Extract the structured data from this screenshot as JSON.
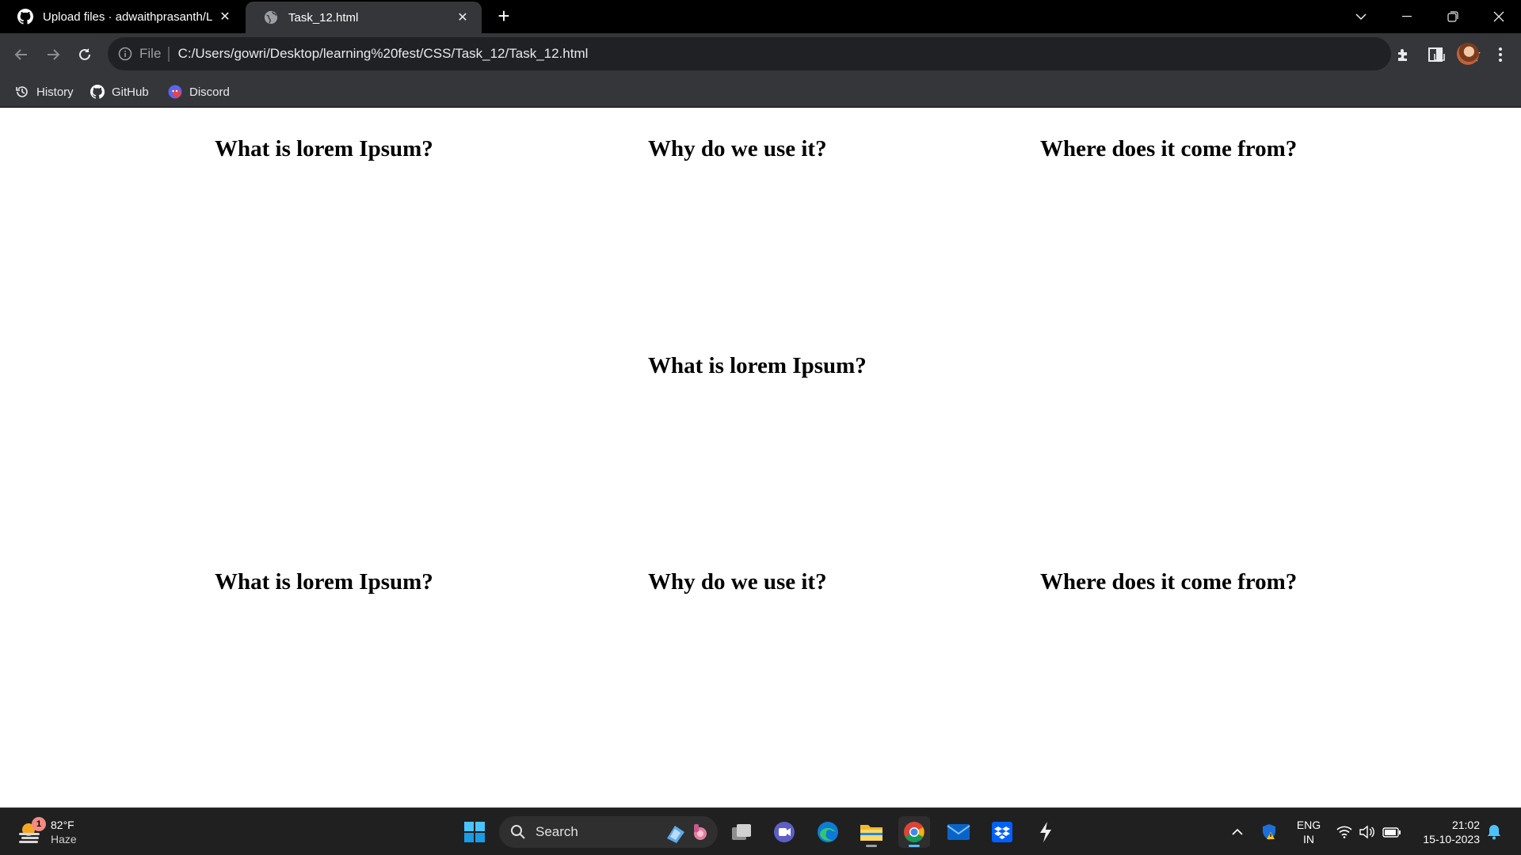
{
  "browser": {
    "tabs": [
      {
        "title": "Upload files · adwaithprasanth/L",
        "favicon": "github-icon",
        "active": false
      },
      {
        "title": "Task_12.html",
        "favicon": "globe-icon",
        "active": true
      }
    ],
    "address": {
      "scheme_label": "File",
      "url": "C:/Users/gowri/Desktop/learning%20fest/CSS/Task_12/Task_12.html"
    },
    "bookmarks": [
      {
        "label": "History",
        "icon": "history-icon"
      },
      {
        "label": "GitHub",
        "icon": "github-icon"
      },
      {
        "label": "Discord",
        "icon": "discord-icon"
      }
    ]
  },
  "page": {
    "rows": [
      [
        "What is lorem Ipsum?",
        "Why do we use it?",
        "Where does it come from?"
      ],
      [
        "What is lorem Ipsum?"
      ],
      [
        "What is lorem Ipsum?",
        "Why do we use it?",
        "Where does it come from?"
      ]
    ]
  },
  "taskbar": {
    "weather": {
      "temp": "82°F",
      "condition": "Haze",
      "badge": "1"
    },
    "search_label": "Search",
    "apps": [
      "start-icon",
      "task-view-icon",
      "meet-icon",
      "edge-icon",
      "file-explorer-icon",
      "chrome-icon",
      "mail-icon",
      "dropbox-icon",
      "app-icon"
    ],
    "language": {
      "line1": "ENG",
      "line2": "IN"
    },
    "clock": {
      "time": "21:02",
      "date": "15-10-2023"
    }
  },
  "colors": {
    "tabstrip_bg": "#000000",
    "toolbar_bg": "#35363a",
    "omnibox_bg": "#202124",
    "page_bg": "#ffffff",
    "taskbar_bg": "#202020",
    "accent": "#4cc2ff"
  }
}
